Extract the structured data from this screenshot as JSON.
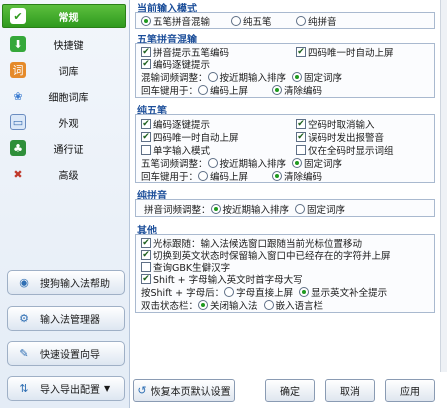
{
  "sidebar": {
    "items": [
      {
        "label": "常规",
        "icon": "general-icon"
      },
      {
        "label": "快捷键",
        "icon": "hotkey-icon"
      },
      {
        "label": "词库",
        "icon": "dictionary-icon"
      },
      {
        "label": "细胞词库",
        "icon": "cell-dictionary-icon"
      },
      {
        "label": "外观",
        "icon": "appearance-icon"
      },
      {
        "label": "通行证",
        "icon": "passport-icon"
      },
      {
        "label": "高级",
        "icon": "advanced-icon"
      }
    ],
    "buttons": [
      {
        "label": "搜狗输入法帮助",
        "icon": "help-icon"
      },
      {
        "label": "输入法管理器",
        "icon": "manager-icon"
      },
      {
        "label": "快速设置向导",
        "icon": "wizard-icon"
      },
      {
        "label": "导入导出配置",
        "icon": "import-export-icon"
      }
    ]
  },
  "current_mode": {
    "title": "当前输入模式",
    "options": [
      "五笔拼音混输",
      "纯五笔",
      "纯拼音"
    ],
    "selected": 0
  },
  "mixed": {
    "title": "五笔拼音混输",
    "hint_wubi": "拼音提示五笔编码",
    "four_code": "四码唯一时自动上屏",
    "stepwise": "编码逐键提示",
    "order_label": "混输词频调整：",
    "order_opts": [
      "按近期输入排序",
      "固定词序"
    ],
    "order_selected": 1,
    "enter_label": "回车键用于：",
    "enter_opts": [
      "编码上屏",
      "清除编码"
    ],
    "enter_selected": 1
  },
  "pure_wubi": {
    "title": "纯五笔",
    "c1": "编码逐键提示",
    "c2": "空码时取消输入",
    "c3": "四码唯一时自动上屏",
    "c4": "误码时发出报警音",
    "c5": "单字输入模式",
    "c6": "仅在全码时显示词组",
    "order_label": "五笔词频调整：",
    "order_opts": [
      "按近期输入排序",
      "固定词序"
    ],
    "order_selected": 1,
    "enter_label": "回车键用于：",
    "enter_opts": [
      "编码上屏",
      "清除编码"
    ],
    "enter_selected": 1
  },
  "pure_pinyin": {
    "title": "纯拼音",
    "order_label": "拼音词频调整：",
    "order_opts": [
      "按近期输入排序",
      "固定词序"
    ],
    "order_selected": 0
  },
  "other": {
    "title": "其他",
    "o1": "光标跟随：输入法候选窗口跟随当前光标位置移动",
    "o2": "切换到英文状态时保留输入窗口中已经存在的字符并上屏",
    "o3": "查询GBK生僻汉字",
    "o4": "Shift + 字母输入英文时首字母大写",
    "shift_label": "按Shift + 字母后：",
    "shift_opts": [
      "字母直接上屏",
      "显示英文补全提示"
    ],
    "shift_selected": 1,
    "dbl_label": "双击状态栏：",
    "dbl_opts": [
      "关闭输入法",
      "嵌入语言栏"
    ],
    "dbl_selected": 0
  },
  "footer": {
    "restore": "恢复本页默认设置",
    "ok": "确定",
    "cancel": "取消",
    "apply": "应用"
  }
}
